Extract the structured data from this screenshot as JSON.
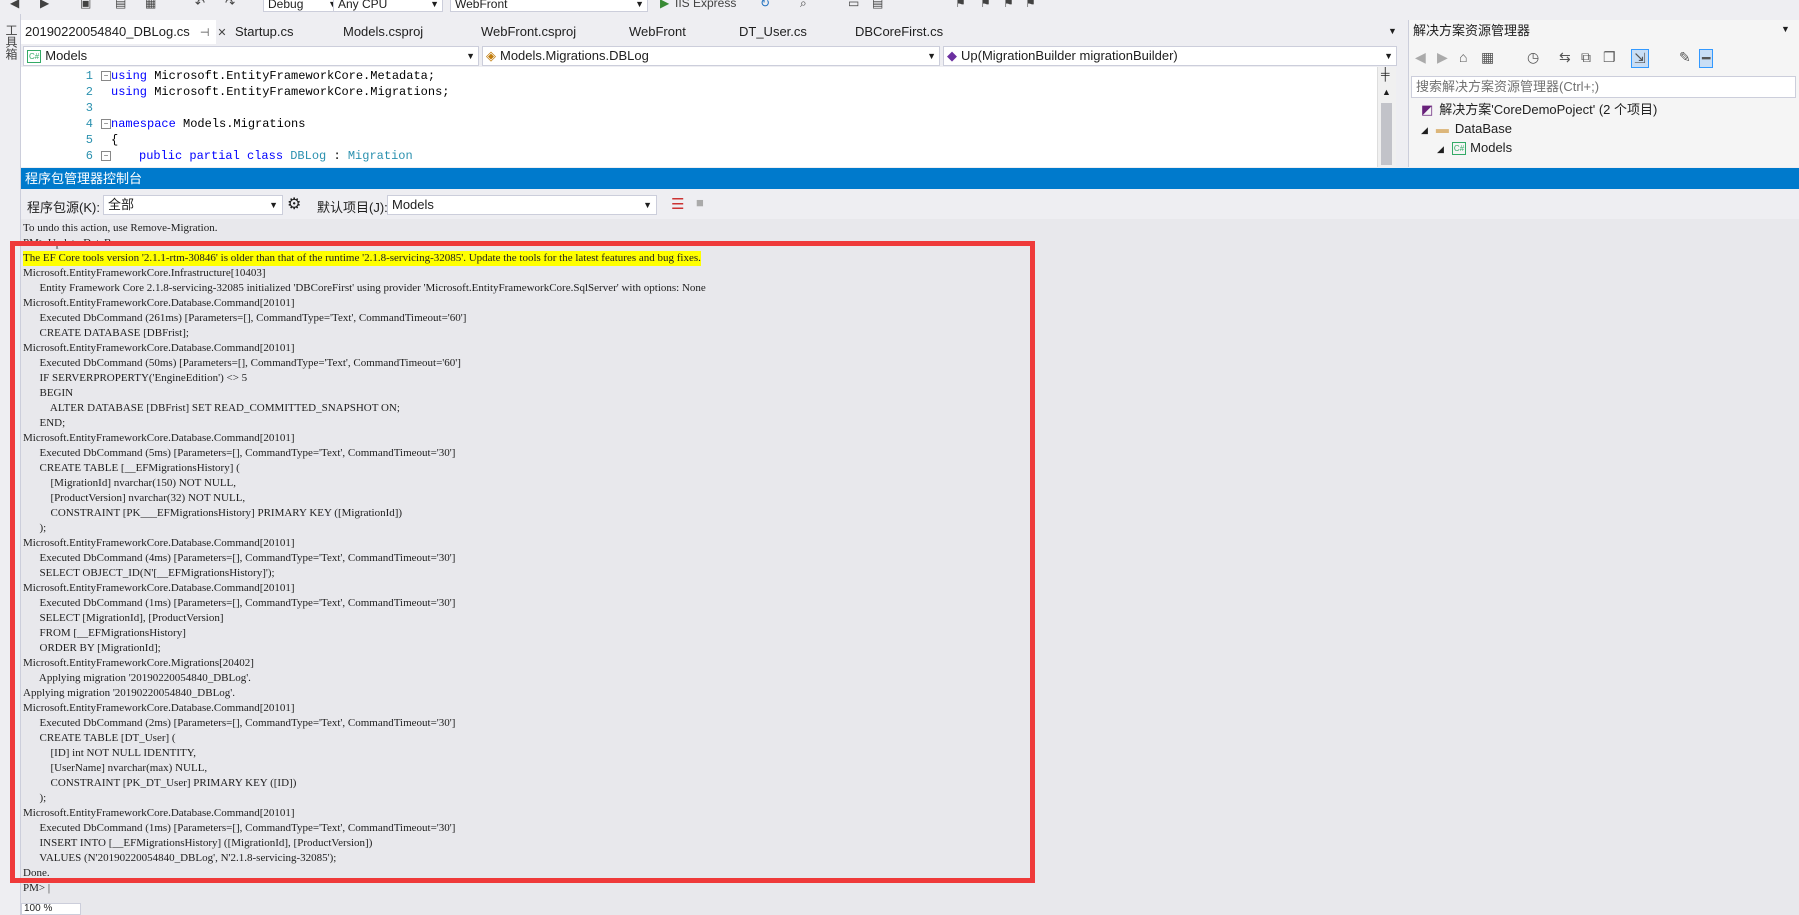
{
  "toolbar": {
    "configuration": "Debug",
    "platform": "Any CPU",
    "startup_project": "WebFront",
    "run_label": "IIS Express"
  },
  "toolbox_label": "工具箱",
  "doc_tabs": [
    {
      "label": "20190220054840_DBLog.cs",
      "active": true
    },
    {
      "label": "Startup.cs"
    },
    {
      "label": "Models.csproj"
    },
    {
      "label": "WebFront.csproj"
    },
    {
      "label": "WebFront"
    },
    {
      "label": "DT_User.cs"
    },
    {
      "label": "DBCoreFirst.cs"
    }
  ],
  "nav_bar": {
    "project": "Models",
    "type": "Models.Migrations.DBLog",
    "member": "Up(MigrationBuilder migrationBuilder)"
  },
  "editor": {
    "line_numbers": [
      "1",
      "2",
      "3",
      "4",
      "5",
      "6"
    ],
    "lines": [
      {
        "kw": "using",
        "rest": " Microsoft.EntityFrameworkCore.Metadata;"
      },
      {
        "kw": "using",
        "rest": " Microsoft.EntityFrameworkCore.Migrations;"
      },
      {
        "kw": "",
        "rest": ""
      },
      {
        "kw": "namespace",
        "rest": " Models.Migrations"
      },
      {
        "kw": "",
        "rest": "{"
      },
      {
        "kw": "public partial class",
        "type1": "DBLog",
        "sep": " : ",
        "type2": "Migration"
      }
    ]
  },
  "solution_explorer": {
    "title": "解决方案资源管理器",
    "search_placeholder": "搜索解决方案资源管理器(Ctrl+;)",
    "solution_label": "解决方案'CoreDemoPoject' (2 个项目)",
    "items": [
      "DataBase",
      "Models"
    ]
  },
  "pmc": {
    "title": "程序包管理器控制台",
    "source_label": "程序包源(K):",
    "source_value": "全部",
    "default_project_label": "默认项目(J):",
    "default_project_value": "Models",
    "zoom": "100 %",
    "lines": [
      "      Entity Framework Core 2.1.8-servicing-32085 initialized 'DBCoreFirst' using provider 'Microsoft.EntityFrameworkCore.SqlServer' with options: None",
      "To undo this action, use Remove-Migration.",
      "PM> Update-DataBase",
      "The EF Core tools version '2.1.1-rtm-30846' is older than that of the runtime '2.1.8-servicing-32085'. Update the tools for the latest features and bug fixes.",
      "Microsoft.EntityFrameworkCore.Infrastructure[10403]",
      "      Entity Framework Core 2.1.8-servicing-32085 initialized 'DBCoreFirst' using provider 'Microsoft.EntityFrameworkCore.SqlServer' with options: None",
      "Microsoft.EntityFrameworkCore.Database.Command[20101]",
      "      Executed DbCommand (261ms) [Parameters=[], CommandType='Text', CommandTimeout='60']",
      "      CREATE DATABASE [DBFrist];",
      "Microsoft.EntityFrameworkCore.Database.Command[20101]",
      "      Executed DbCommand (50ms) [Parameters=[], CommandType='Text', CommandTimeout='60']",
      "      IF SERVERPROPERTY('EngineEdition') <> 5",
      "      BEGIN",
      "          ALTER DATABASE [DBFrist] SET READ_COMMITTED_SNAPSHOT ON;",
      "      END;",
      "Microsoft.EntityFrameworkCore.Database.Command[20101]",
      "      Executed DbCommand (5ms) [Parameters=[], CommandType='Text', CommandTimeout='30']",
      "      CREATE TABLE [__EFMigrationsHistory] (",
      "          [MigrationId] nvarchar(150) NOT NULL,",
      "          [ProductVersion] nvarchar(32) NOT NULL,",
      "          CONSTRAINT [PK___EFMigrationsHistory] PRIMARY KEY ([MigrationId])",
      "      );",
      "Microsoft.EntityFrameworkCore.Database.Command[20101]",
      "      Executed DbCommand (4ms) [Parameters=[], CommandType='Text', CommandTimeout='30']",
      "      SELECT OBJECT_ID(N'[__EFMigrationsHistory]');",
      "Microsoft.EntityFrameworkCore.Database.Command[20101]",
      "      Executed DbCommand (1ms) [Parameters=[], CommandType='Text', CommandTimeout='30']",
      "      SELECT [MigrationId], [ProductVersion]",
      "      FROM [__EFMigrationsHistory]",
      "      ORDER BY [MigrationId];",
      "Microsoft.EntityFrameworkCore.Migrations[20402]",
      "      Applying migration '20190220054840_DBLog'.",
      "Applying migration '20190220054840_DBLog'.",
      "Microsoft.EntityFrameworkCore.Database.Command[20101]",
      "      Executed DbCommand (2ms) [Parameters=[], CommandType='Text', CommandTimeout='30']",
      "      CREATE TABLE [DT_User] (",
      "          [ID] int NOT NULL IDENTITY,",
      "          [UserName] nvarchar(max) NULL,",
      "          CONSTRAINT [PK_DT_User] PRIMARY KEY ([ID])",
      "      );",
      "Microsoft.EntityFrameworkCore.Database.Command[20101]",
      "      Executed DbCommand (1ms) [Parameters=[], CommandType='Text', CommandTimeout='30']",
      "      INSERT INTO [__EFMigrationsHistory] ([MigrationId], [ProductVersion])",
      "      VALUES (N'20190220054840_DBLog', N'2.1.8-servicing-32085');",
      "Done.",
      "PM> |"
    ],
    "highlight_line_index": 3
  },
  "colors": {
    "accent": "#007acc",
    "highlight": "#ffff00",
    "annotation_box": "#ef3a3a"
  }
}
